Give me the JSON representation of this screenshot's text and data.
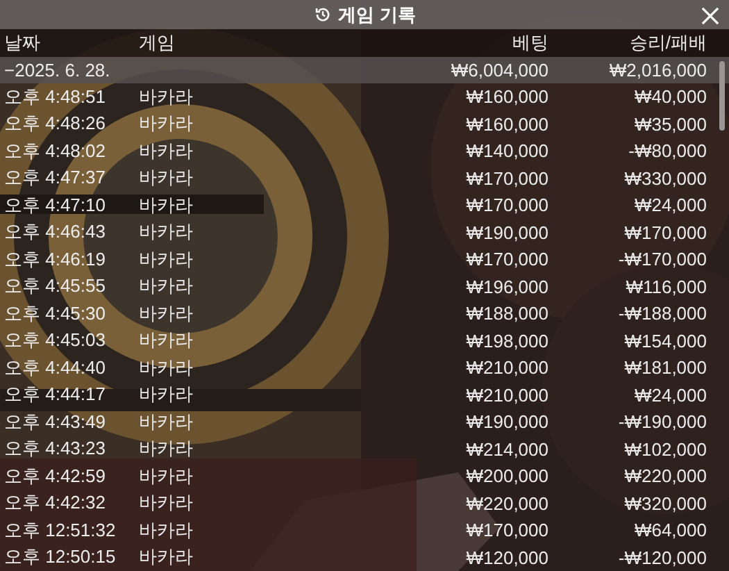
{
  "window": {
    "title": "게임 기록"
  },
  "table": {
    "columns": [
      "날짜",
      "게임",
      "베팅",
      "승리/패배"
    ],
    "group": {
      "label": "−2025. 6. 28.",
      "bet": "₩6,004,000",
      "result": "₩2,016,000"
    },
    "rows": [
      {
        "time": "오후 4:48:51",
        "game": "바카라",
        "bet": "₩160,000",
        "result": "₩40,000"
      },
      {
        "time": "오후 4:48:26",
        "game": "바카라",
        "bet": "₩160,000",
        "result": "₩35,000"
      },
      {
        "time": "오후 4:48:02",
        "game": "바카라",
        "bet": "₩140,000",
        "result": "-₩80,000"
      },
      {
        "time": "오후 4:47:37",
        "game": "바카라",
        "bet": "₩170,000",
        "result": "₩330,000"
      },
      {
        "time": "오후 4:47:10",
        "game": "바카라",
        "bet": "₩170,000",
        "result": "₩24,000"
      },
      {
        "time": "오후 4:46:43",
        "game": "바카라",
        "bet": "₩190,000",
        "result": "₩170,000"
      },
      {
        "time": "오후 4:46:19",
        "game": "바카라",
        "bet": "₩170,000",
        "result": "-₩170,000"
      },
      {
        "time": "오후 4:45:55",
        "game": "바카라",
        "bet": "₩196,000",
        "result": "₩116,000"
      },
      {
        "time": "오후 4:45:30",
        "game": "바카라",
        "bet": "₩188,000",
        "result": "-₩188,000"
      },
      {
        "time": "오후 4:45:03",
        "game": "바카라",
        "bet": "₩198,000",
        "result": "₩154,000"
      },
      {
        "time": "오후 4:44:40",
        "game": "바카라",
        "bet": "₩210,000",
        "result": "₩181,000"
      },
      {
        "time": "오후 4:44:17",
        "game": "바카라",
        "bet": "₩210,000",
        "result": "₩24,000"
      },
      {
        "time": "오후 4:43:49",
        "game": "바카라",
        "bet": "₩190,000",
        "result": "-₩190,000"
      },
      {
        "time": "오후 4:43:23",
        "game": "바카라",
        "bet": "₩214,000",
        "result": "₩102,000"
      },
      {
        "time": "오후 4:42:59",
        "game": "바카라",
        "bet": "₩200,000",
        "result": "₩220,000"
      },
      {
        "time": "오후 4:42:32",
        "game": "바카라",
        "bet": "₩220,000",
        "result": "₩320,000"
      },
      {
        "time": "오후 12:51:32",
        "game": "바카라",
        "bet": "₩170,000",
        "result": "₩64,000"
      },
      {
        "time": "오후 12:50:15",
        "game": "바카라",
        "bet": "₩120,000",
        "result": "-₩120,000"
      }
    ]
  }
}
